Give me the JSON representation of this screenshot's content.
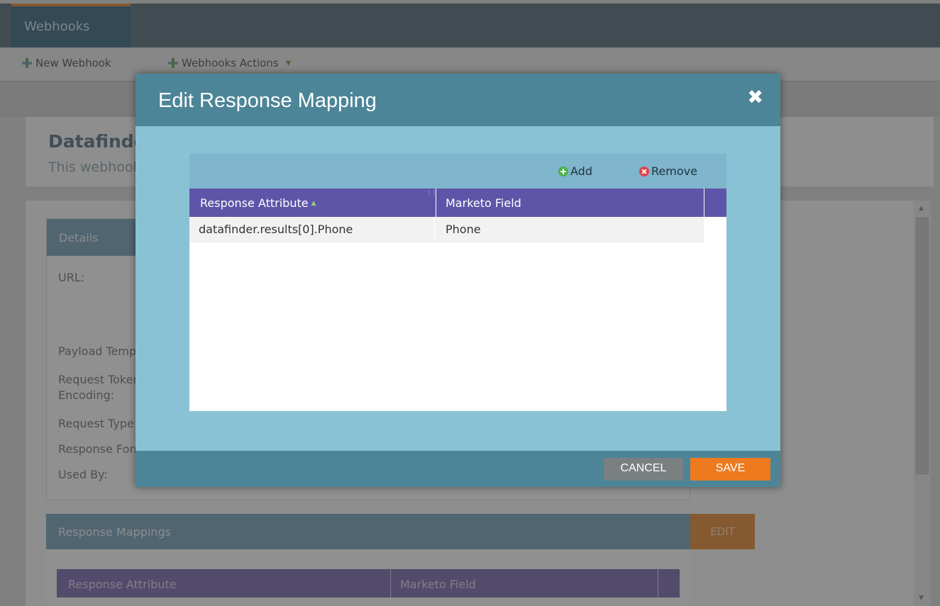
{
  "app": {
    "tab": "Webhooks",
    "toolbar": {
      "new_webhook": "New Webhook",
      "webhooks_actions": "Webhooks Actions"
    },
    "title_card": {
      "title": "Datafinder Phone",
      "subtitle": "This webhook calls Datafinder to fetch phone"
    },
    "details": {
      "header": "Details",
      "labels": {
        "url": "URL:",
        "payload": "Payload Template:",
        "request_token": "Request Token",
        "encoding": "Encoding:",
        "request_type": "Request Type:",
        "response_format": "Response Format:",
        "used_by": "Used By:"
      }
    },
    "response_mappings": {
      "header": "Response Mappings",
      "edit_label": "EDIT",
      "columns": [
        "Response Attribute",
        "Marketo Field"
      ]
    }
  },
  "modal": {
    "title": "Edit Response Mapping",
    "close_symbol": "✖",
    "toolbar": {
      "add_label": "Add",
      "remove_label": "Remove"
    },
    "columns": [
      "Response Attribute",
      "Marketo Field"
    ],
    "rows": [
      {
        "response_attribute": "datafinder.results[0].Phone",
        "marketo_field": "Phone"
      }
    ],
    "footer": {
      "cancel_label": "CANCEL",
      "save_label": "SAVE"
    }
  },
  "colors": {
    "modal_header": "#4d8598",
    "modal_body": "#89c2d4",
    "grid_header": "#5f55a8",
    "save_button": "#ee7a1f",
    "cancel_button": "#7a7f82"
  }
}
